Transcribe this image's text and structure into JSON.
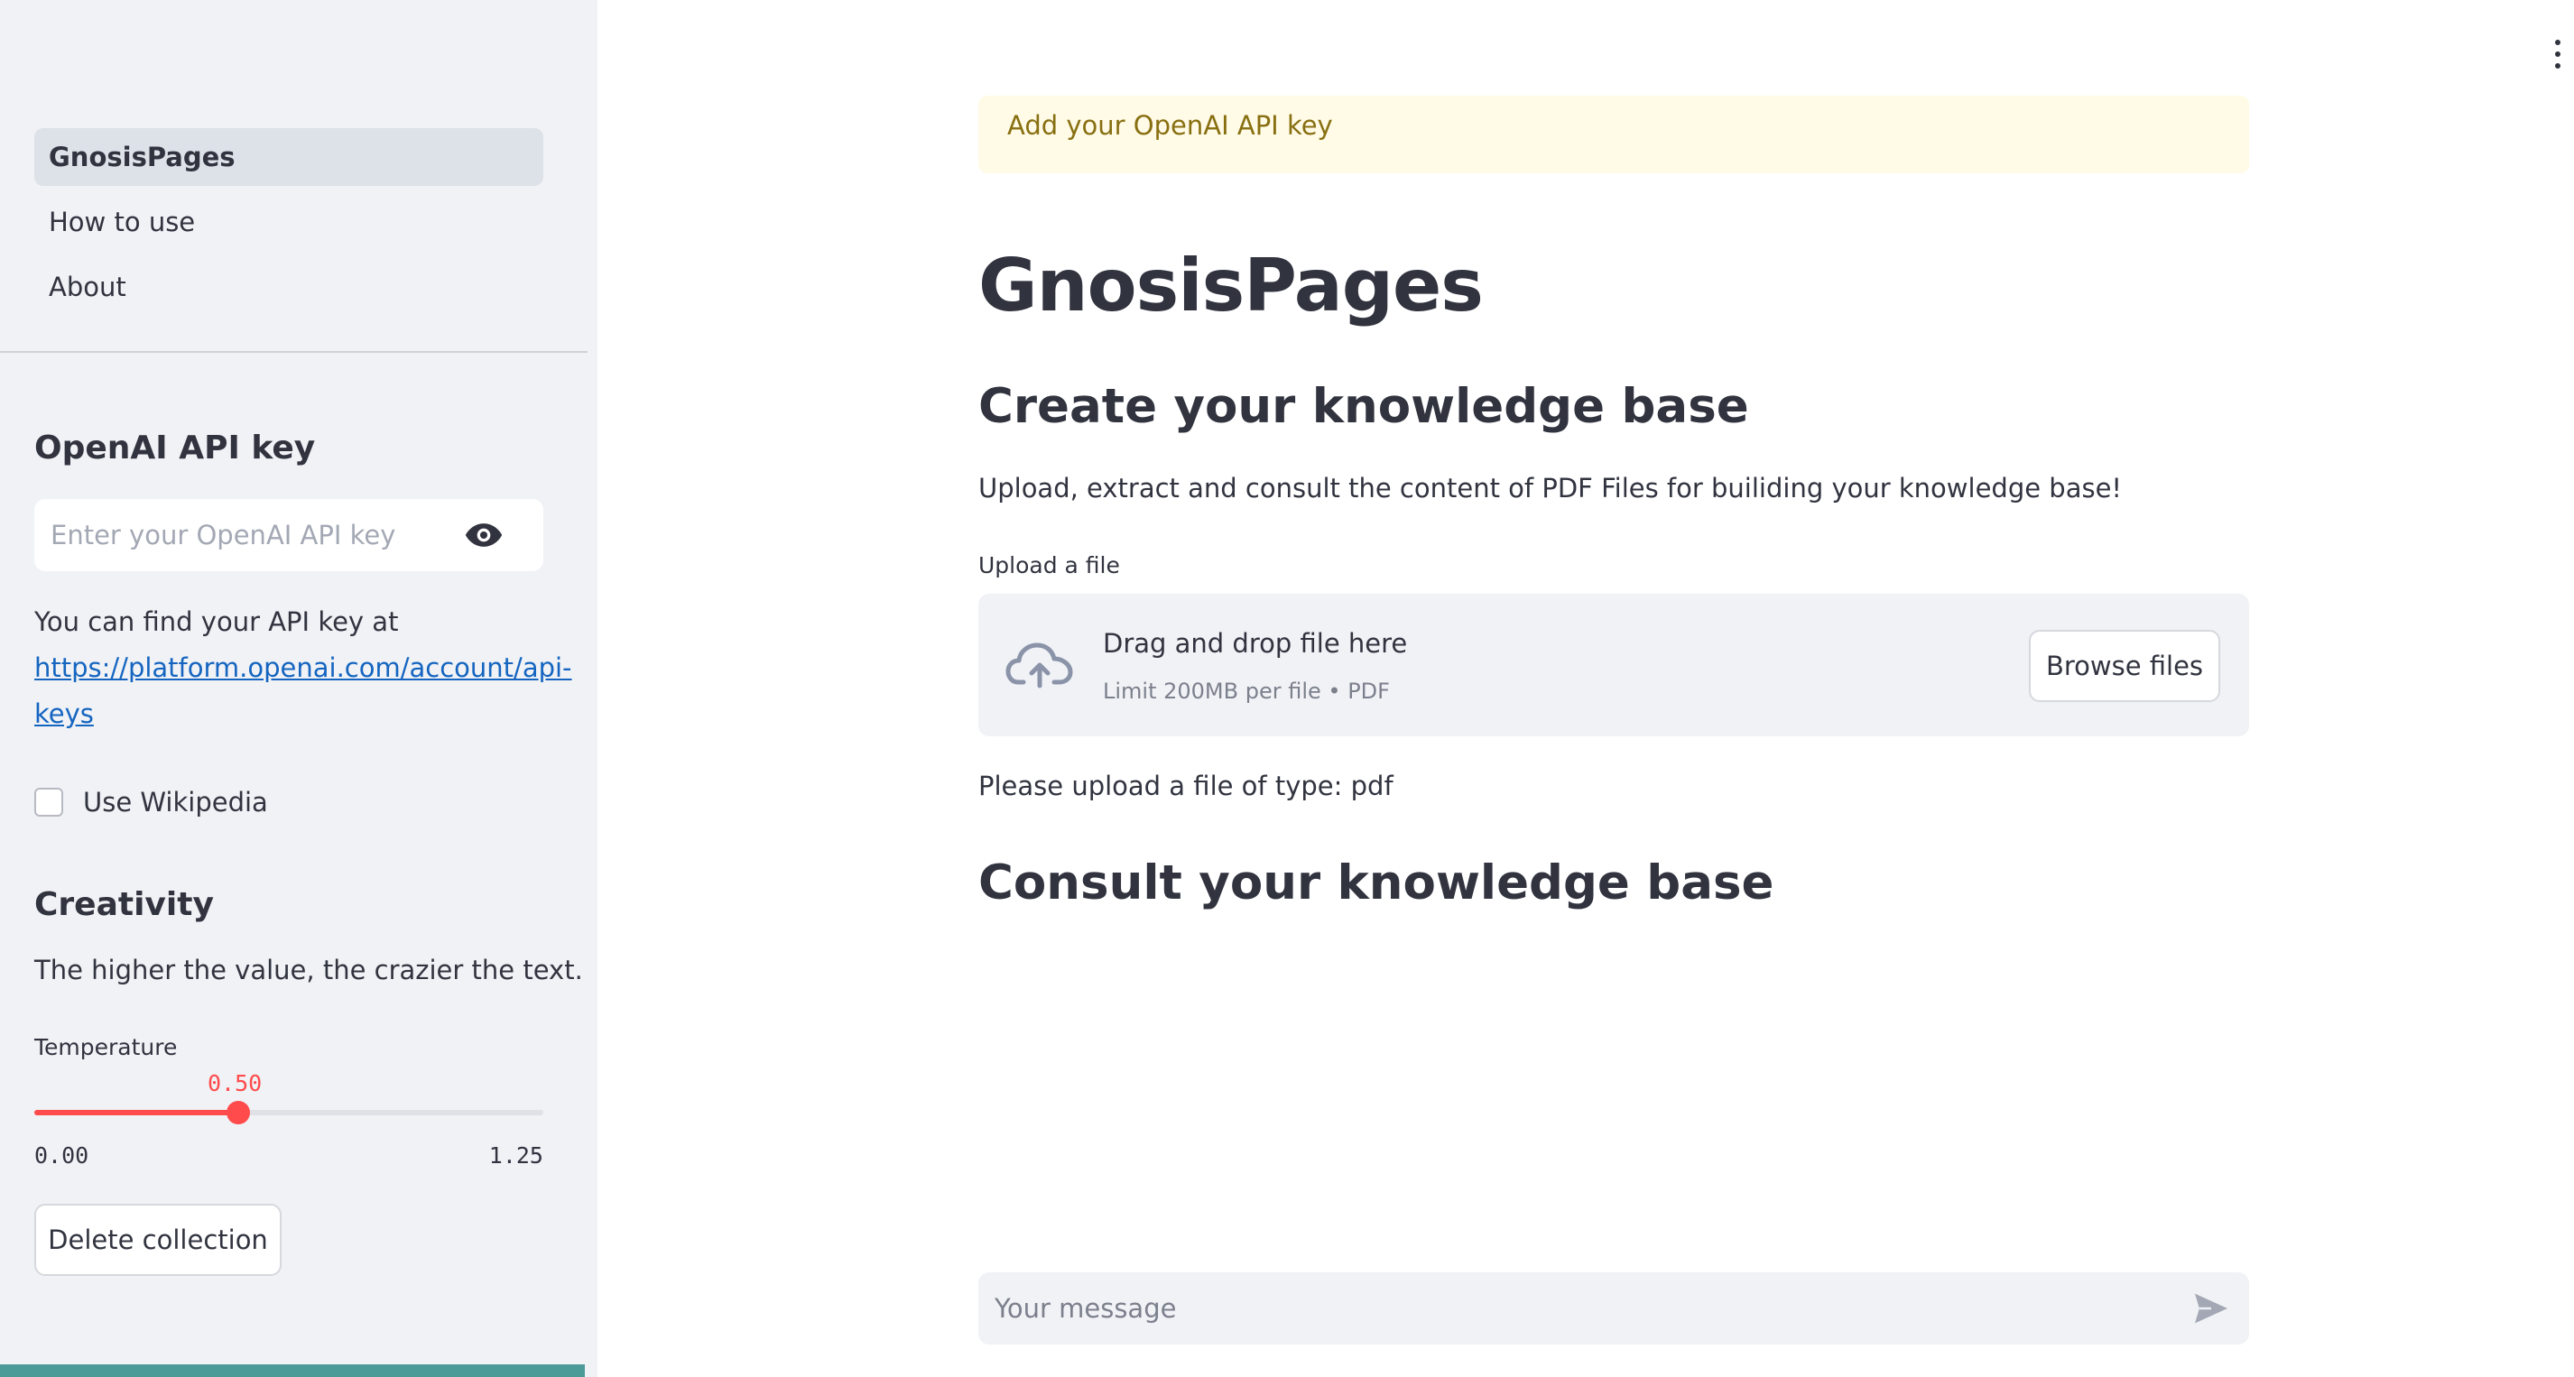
{
  "sidebar": {
    "nav": [
      {
        "label": "GnosisPages",
        "active": true
      },
      {
        "label": "How to use",
        "active": false
      },
      {
        "label": "About",
        "active": false
      }
    ],
    "api_heading": "OpenAI API key",
    "api_placeholder": "Enter your OpenAI API key",
    "api_help_text": "You can find your API key at",
    "api_help_link": "https://platform.openai.com/account/api-keys",
    "wikipedia_label": "Use Wikipedia",
    "wikipedia_checked": false,
    "creativity_heading": "Creativity",
    "creativity_desc": "The higher the value, the crazier the text.",
    "temperature": {
      "label": "Temperature",
      "value": "0.50",
      "min": "0.00",
      "max": "1.25",
      "fraction": 0.4
    },
    "delete_button": "Delete collection"
  },
  "main": {
    "warning": "Add your OpenAI API key",
    "title": "GnosisPages",
    "create_heading": "Create your knowledge base",
    "create_desc": "Upload, extract and consult the content of PDF Files for builiding your knowledge base!",
    "upload_label": "Upload a file",
    "dropzone_title": "Drag and drop file here",
    "dropzone_limit": "Limit 200MB per file • PDF",
    "browse_button": "Browse files",
    "upload_message": "Please upload a file of type: pdf",
    "consult_heading": "Consult your knowledge base",
    "chat_placeholder": "Your message"
  },
  "colors": {
    "accent": "#ff4b4b",
    "sidebar_bg": "#f0f2f6",
    "warning_bg": "#fffbe6",
    "warning_text": "#886f11",
    "link": "#1565c0"
  }
}
